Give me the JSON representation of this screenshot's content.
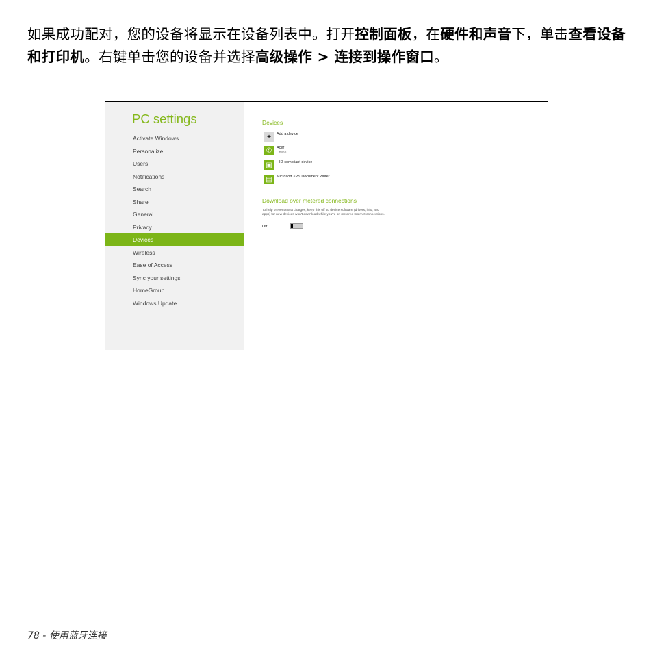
{
  "instruction": {
    "t1": "如果成功配对，您的设备将显示在设备列表中。打开",
    "b1": "控制面板",
    "t2": "，在",
    "b2": "硬件和声音",
    "t3": "下，单击",
    "b3": "查看设备和打印机",
    "t4": "。右键单击您的设备并选择",
    "b4": "高级操作 > 连接到操作窗口",
    "t5": "。"
  },
  "screenshot": {
    "sidebar": {
      "title": "PC settings",
      "items": [
        {
          "label": "Activate Windows"
        },
        {
          "label": "Personalize"
        },
        {
          "label": "Users"
        },
        {
          "label": "Notifications"
        },
        {
          "label": "Search"
        },
        {
          "label": "Share"
        },
        {
          "label": "General"
        },
        {
          "label": "Privacy"
        },
        {
          "label": "Devices"
        },
        {
          "label": "Wireless"
        },
        {
          "label": "Ease of Access"
        },
        {
          "label": "Sync your settings"
        },
        {
          "label": "HomeGroup"
        },
        {
          "label": "Windows Update"
        }
      ],
      "active_index": 8
    },
    "devices": {
      "heading": "Devices",
      "add_label": "Add a device",
      "list": [
        {
          "name": "Acer",
          "status": "Offline",
          "icon": "phone-icon"
        },
        {
          "name": "HID-compliant device",
          "status": "",
          "icon": "hid-device-icon"
        },
        {
          "name": "Microsoft XPS Document Writer",
          "status": "",
          "icon": "printer-document-icon"
        }
      ]
    },
    "metered": {
      "heading": "Download over metered connections",
      "description": "To help prevent extra charges, keep this off so device software (drivers, info, and apps) for new devices won't download while you're on metered Internet connections.",
      "toggle_label": "Off",
      "toggle_on": false
    },
    "accent_color": "#7cb518"
  },
  "footer": {
    "text": "78 - 使用蓝牙连接"
  }
}
